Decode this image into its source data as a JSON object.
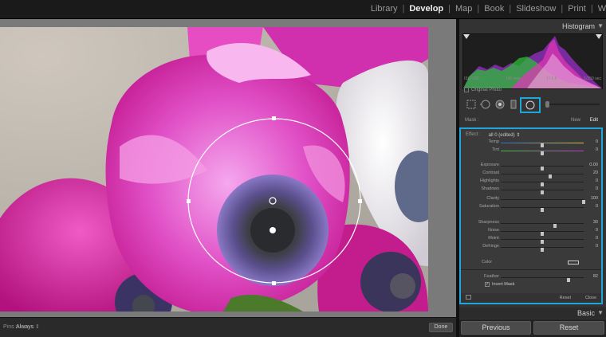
{
  "top_nav": {
    "modules": [
      "Library",
      "Develop",
      "Map",
      "Book",
      "Slideshow",
      "Print",
      "We"
    ],
    "active": "Develop",
    "separator": "|"
  },
  "canvas": {
    "image_subject": "pink anemone flower",
    "overlay": "radial-filter-ellipse"
  },
  "toolbar": {
    "pins_label": "Pins :",
    "pins_value": "Always",
    "pins_arrow": "⇕",
    "done_label": "Done"
  },
  "histogram": {
    "title": "Histogram",
    "info": [
      "ISO 200",
      "140 mm",
      "f / 5.6",
      "1/250 sec"
    ],
    "original_photo_label": "Original Photo"
  },
  "mask": {
    "label": "Mask :",
    "new_label": "New",
    "edit_label": "Edit"
  },
  "effect": {
    "label": "Effect :",
    "value": "all 0 (edited) ⇕"
  },
  "sliders": [
    {
      "label": "Temp",
      "value": "0",
      "pos": 0.5
    },
    {
      "label": "Tint",
      "value": "0",
      "pos": 0.5
    },
    {
      "label": "Exposure",
      "value": "0.00",
      "pos": 0.5
    },
    {
      "label": "Contrast",
      "value": "20",
      "pos": 0.6
    },
    {
      "label": "Highlights",
      "value": "0",
      "pos": 0.5
    },
    {
      "label": "Shadows",
      "value": "0",
      "pos": 0.5
    },
    {
      "label": "Clarity",
      "value": "100",
      "pos": 1.0
    },
    {
      "label": "Saturation",
      "value": "0",
      "pos": 0.5
    },
    {
      "label": "Sharpness",
      "value": "30",
      "pos": 0.65
    },
    {
      "label": "Noise",
      "value": "0",
      "pos": 0.5
    },
    {
      "label": "Moiré",
      "value": "0",
      "pos": 0.5
    },
    {
      "label": "Defringe",
      "value": "0",
      "pos": 0.5
    }
  ],
  "color_label": "Color",
  "feather": {
    "label": "Feather",
    "value": "82",
    "pos": 0.82
  },
  "invert_mask": {
    "label": "Invert Mask",
    "checked": "✓"
  },
  "panel_footer": {
    "reset": "Reset",
    "close": "Close"
  },
  "basic": {
    "title": "Basic"
  },
  "buttons": {
    "previous": "Previous",
    "reset": "Reset"
  },
  "colors": {
    "accent": "#1fa6dc",
    "panel": "#333333",
    "canvas": "#7a7a7a"
  }
}
